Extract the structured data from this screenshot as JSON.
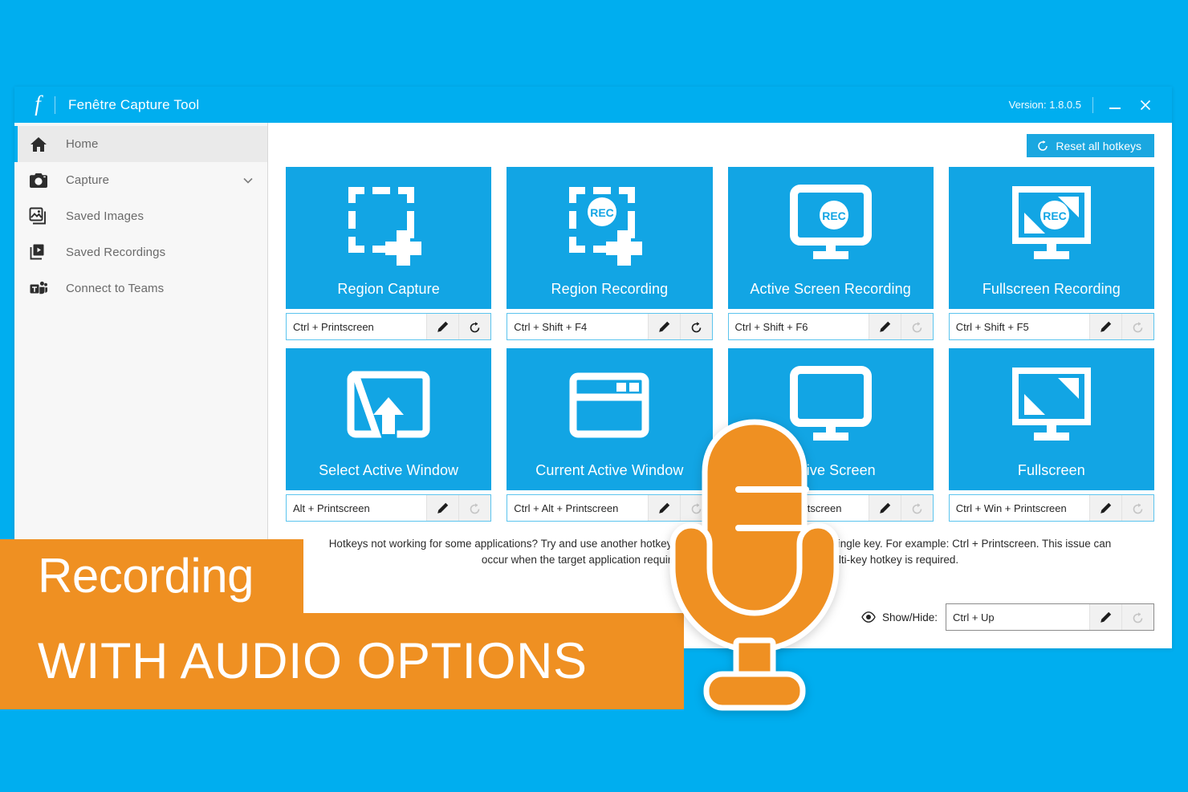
{
  "window": {
    "logo": "f",
    "title": "Fenêtre Capture Tool",
    "version": "Version: 1.8.0.5",
    "minimize_label": "Minimize",
    "close_label": "Close"
  },
  "sidebar": {
    "items": [
      {
        "label": "Home",
        "icon": "home-icon",
        "selected": true,
        "chevron": false
      },
      {
        "label": "Capture",
        "icon": "camera-icon",
        "selected": false,
        "chevron": true
      },
      {
        "label": "Saved Images",
        "icon": "images-icon",
        "selected": false,
        "chevron": false
      },
      {
        "label": "Saved Recordings",
        "icon": "video-library-icon",
        "selected": false,
        "chevron": false
      },
      {
        "label": "Connect to Teams",
        "icon": "teams-icon",
        "selected": false,
        "chevron": false
      }
    ]
  },
  "toolbar": {
    "reset_all_label": "Reset all hotkeys",
    "reset_all_icon": "reset-circular-arrow-icon"
  },
  "tiles": [
    {
      "label": "Region Capture",
      "icon": "region-capture-icon",
      "hotkey": "Ctrl + Printscreen",
      "edit_icon": "pencil-icon",
      "reset_icon": "reset-arrow-icon",
      "reset_enabled": true
    },
    {
      "label": "Region Recording",
      "icon": "region-recording-rec-icon",
      "hotkey": "Ctrl + Shift + F4",
      "edit_icon": "pencil-icon",
      "reset_icon": "reset-arrow-icon",
      "reset_enabled": true
    },
    {
      "label": "Active Screen Recording",
      "icon": "monitor-rec-icon",
      "hotkey": "Ctrl + Shift + F6",
      "edit_icon": "pencil-icon",
      "reset_icon": "reset-arrow-icon",
      "reset_enabled": false
    },
    {
      "label": "Fullscreen Recording",
      "icon": "monitor-fullscreen-rec-icon",
      "hotkey": "Ctrl + Shift + F5",
      "edit_icon": "pencil-icon",
      "reset_icon": "reset-arrow-icon",
      "reset_enabled": false
    },
    {
      "label": "Select Active Window",
      "icon": "select-window-arrow-icon",
      "hotkey": "Alt + Printscreen",
      "edit_icon": "pencil-icon",
      "reset_icon": "reset-arrow-icon",
      "reset_enabled": false
    },
    {
      "label": "Current Active Window",
      "icon": "browser-window-icon",
      "hotkey": "Ctrl + Alt + Printscreen",
      "edit_icon": "pencil-icon",
      "reset_icon": "reset-arrow-icon",
      "reset_enabled": false
    },
    {
      "label": "Active Screen",
      "icon": "monitor-icon",
      "hotkey": "Alt + Win + Printscreen",
      "edit_icon": "pencil-icon",
      "reset_icon": "reset-arrow-icon",
      "reset_enabled": false
    },
    {
      "label": "Fullscreen",
      "icon": "monitor-fullscreen-icon",
      "hotkey": "Ctrl + Win + Printscreen",
      "edit_icon": "pencil-icon",
      "reset_icon": "reset-arrow-icon",
      "reset_enabled": false
    }
  ],
  "footer": {
    "note": "Hotkeys not working for some applications? Try and use another hotkey to use a modifier together with a single key. For example: Ctrl + Printscreen. This issue can occur when the target application requires administrator rights. Using a multi-key hotkey is required."
  },
  "showhide": {
    "eye_icon": "eye-icon",
    "label": "Show/Hide:",
    "hotkey": "Ctrl + Up",
    "edit_icon": "pencil-icon",
    "reset_icon": "reset-arrow-icon"
  },
  "promo": {
    "line1": "Recording",
    "line2": "WITH AUDIO OPTIONS",
    "icon": "microphone-icon"
  },
  "colors": {
    "background_blue": "#00AEEF",
    "tile_blue": "#12A5E4",
    "accent_orange": "#EF9022",
    "sidebar_gray": "#F7F7F7"
  }
}
